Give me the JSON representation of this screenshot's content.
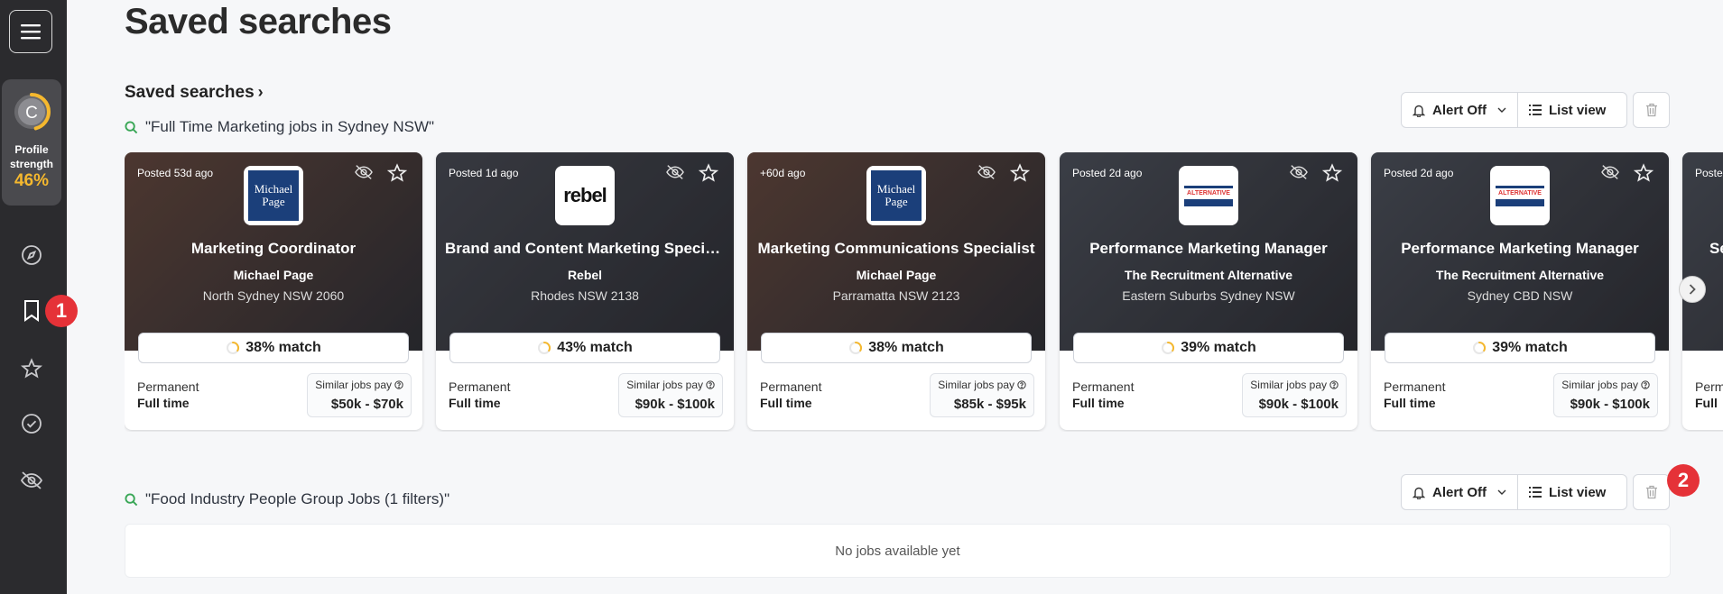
{
  "page": {
    "title": "Saved searches"
  },
  "sidebar": {
    "profile": {
      "initial": "C",
      "label_line1": "Profile",
      "label_line2": "strength",
      "percent": "46%",
      "progress": 0.46
    },
    "badge1": "1"
  },
  "section": {
    "title": "Saved searches",
    "chevron": "›"
  },
  "searches": [
    {
      "query": "\"Full Time Marketing jobs in Sydney NSW\"",
      "alert_label": "Alert Off",
      "view_label": "List view"
    },
    {
      "query": "\"Food Industry People Group Jobs (1 filters)\"",
      "alert_label": "Alert Off",
      "view_label": "List view",
      "empty_text": "No jobs available yet",
      "badge": "2"
    }
  ],
  "cards": [
    {
      "posted": "Posted 53d ago",
      "logo": "Michael Page",
      "logo_kind": "mp",
      "title": "Marketing Coordinator",
      "company": "Michael Page",
      "location": "North Sydney NSW 2060",
      "match": "38% match",
      "work_type": "Permanent",
      "work_time": "Full time",
      "pay_label": "Similar jobs pay",
      "pay_range": "$50k - $70k",
      "bg": "#6b4a3c"
    },
    {
      "posted": "Posted 1d ago",
      "logo": "rebel",
      "logo_kind": "rebel",
      "title": "Brand and Content Marketing Specia...",
      "company": "Rebel",
      "location": "Rhodes NSW 2138",
      "match": "43% match",
      "work_type": "Permanent",
      "work_time": "Full time",
      "pay_label": "Similar jobs pay",
      "pay_range": "$90k - $100k",
      "bg": "#4a4d55"
    },
    {
      "posted": "+60d ago",
      "logo": "Michael Page",
      "logo_kind": "mp",
      "title": "Marketing Communications Specialist",
      "company": "Michael Page",
      "location": "Parramatta NSW 2123",
      "match": "38% match",
      "work_type": "Permanent",
      "work_time": "Full time",
      "pay_label": "Similar jobs pay",
      "pay_range": "$85k - $95k",
      "bg": "#6b4a3c"
    },
    {
      "posted": "Posted 2d ago",
      "logo": "ALTERNATIVE",
      "logo_kind": "tra",
      "title": "Performance Marketing Manager",
      "company": "The Recruitment Alternative",
      "location": "Eastern Suburbs Sydney NSW",
      "match": "39% match",
      "work_type": "Permanent",
      "work_time": "Full time",
      "pay_label": "Similar jobs pay",
      "pay_range": "$90k - $100k",
      "bg": "#50555e"
    },
    {
      "posted": "Posted 2d ago",
      "logo": "ALTERNATIVE",
      "logo_kind": "tra",
      "title": "Performance Marketing Manager",
      "company": "The Recruitment Alternative",
      "location": "Sydney CBD NSW",
      "match": "39% match",
      "work_type": "Permanent",
      "work_time": "Full time",
      "pay_label": "Similar jobs pay",
      "pay_range": "$90k - $100k",
      "bg": "#50555e"
    },
    {
      "posted": "Poste",
      "logo": "",
      "logo_kind": "none",
      "title": "Se",
      "company": "",
      "location": "",
      "match": "",
      "work_type": "Perm",
      "work_time": "Full",
      "pay_label": "",
      "pay_range": "",
      "bg": "#50555e"
    }
  ]
}
